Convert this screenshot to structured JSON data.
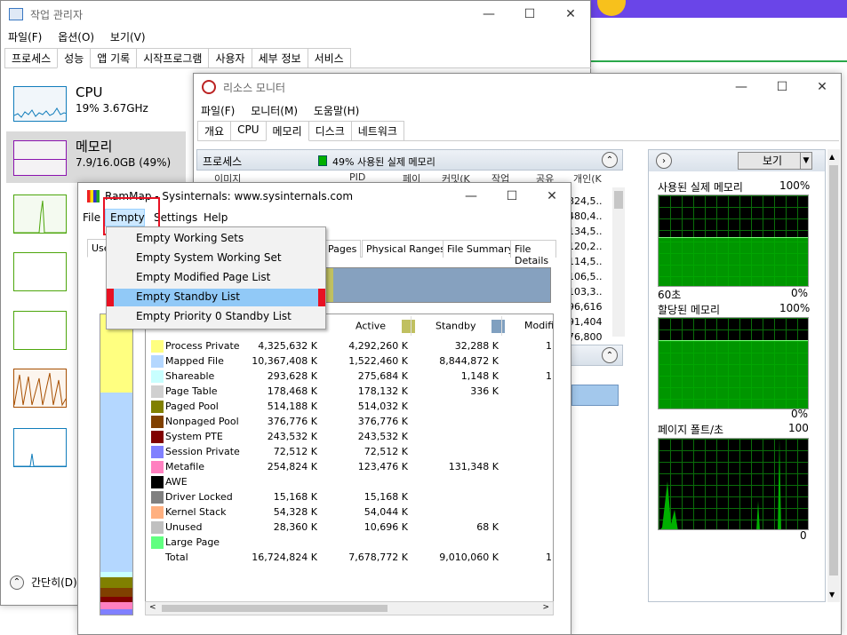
{
  "taskmgr": {
    "title": "작업 관리자",
    "menu": [
      "파일(F)",
      "옵션(O)",
      "보기(V)"
    ],
    "tabs": [
      "프로세스",
      "성능",
      "앱 기록",
      "시작프로그램",
      "사용자",
      "세부 정보",
      "서비스"
    ],
    "cpu": {
      "name": "CPU",
      "value": "19% 3.67GHz"
    },
    "memory": {
      "name": "메모리",
      "value": "7.9/16.0GB (49%)"
    },
    "fewer_details": "간단히(D)"
  },
  "resmon": {
    "title": "리소스 모니터",
    "menu": [
      "파일(F)",
      "모니터(M)",
      "도움말(H)"
    ],
    "tabs": [
      "개요",
      "CPU",
      "메모리",
      "디스크",
      "네트워크"
    ],
    "process_label": "프로세스",
    "usage_text": "49% 사용된 실제 메모리",
    "col_headers": [
      "이미지",
      "PID",
      "페이",
      "커밋(K",
      "작업",
      "공유",
      "개인(K"
    ],
    "col_values": [
      "824,5..",
      "480,4..",
      "134,5..",
      "120,2..",
      "114,5..",
      "106,5..",
      "103,3..",
      "96,616",
      "91,404",
      "76,800"
    ],
    "view_button": "보기",
    "graph1": {
      "title": "사용된 실제 메모리",
      "max": "100%",
      "time": "60초",
      "min": "0%"
    },
    "graph2": {
      "title": "할당된 메모리",
      "max": "100%",
      "min": "0%"
    },
    "graph3": {
      "title": "페이지 폴트/초",
      "max": "100",
      "min": "0"
    }
  },
  "rammap": {
    "title": "RamMap - Sysinternals: www.sysinternals.com",
    "menu": [
      "File",
      "Empty",
      "Settings",
      "Help"
    ],
    "tabs_visible": [
      "Use",
      "Pages",
      "Physical Ranges",
      "File Summary",
      "File Details"
    ],
    "dropdown": [
      "Empty Working Sets",
      "Empty System Working Set",
      "Empty Modified Page List",
      "Empty Standby List",
      "Empty Priority 0 Standby List"
    ],
    "headers": {
      "active": "Active",
      "standby": "Standby",
      "modified": "Modifie"
    },
    "rows": [
      {
        "name": "Process Private",
        "color": "#ffff80",
        "total": "4,325,632 K",
        "active": "4,292,260 K",
        "standby": "32,288 K",
        "modified": "1"
      },
      {
        "name": "Mapped File",
        "color": "#b4d7ff",
        "total": "10,367,408 K",
        "active": "1,522,460 K",
        "standby": "8,844,872 K",
        "modified": ""
      },
      {
        "name": "Shareable",
        "color": "#c8ffff",
        "total": "293,628 K",
        "active": "275,684 K",
        "standby": "1,148 K",
        "modified": "1"
      },
      {
        "name": "Page Table",
        "color": "#d0d0d0",
        "total": "178,468 K",
        "active": "178,132 K",
        "standby": "336 K",
        "modified": ""
      },
      {
        "name": "Paged Pool",
        "color": "#808000",
        "total": "514,188 K",
        "active": "514,032 K",
        "standby": "",
        "modified": ""
      },
      {
        "name": "Nonpaged Pool",
        "color": "#804000",
        "total": "376,776 K",
        "active": "376,776 K",
        "standby": "",
        "modified": ""
      },
      {
        "name": "System PTE",
        "color": "#800000",
        "total": "243,532 K",
        "active": "243,532 K",
        "standby": "",
        "modified": ""
      },
      {
        "name": "Session Private",
        "color": "#8080ff",
        "total": "72,512 K",
        "active": "72,512 K",
        "standby": "",
        "modified": ""
      },
      {
        "name": "Metafile",
        "color": "#ff80c0",
        "total": "254,824 K",
        "active": "123,476 K",
        "standby": "131,348 K",
        "modified": ""
      },
      {
        "name": "AWE",
        "color": "#000000",
        "total": "",
        "active": "",
        "standby": "",
        "modified": ""
      },
      {
        "name": "Driver Locked",
        "color": "#808080",
        "total": "15,168 K",
        "active": "15,168 K",
        "standby": "",
        "modified": ""
      },
      {
        "name": "Kernel Stack",
        "color": "#ffb080",
        "total": "54,328 K",
        "active": "54,044 K",
        "standby": "",
        "modified": ""
      },
      {
        "name": "Unused",
        "color": "#c0c0c0",
        "total": "28,360 K",
        "active": "10,696 K",
        "standby": "68 K",
        "modified": ""
      },
      {
        "name": "Large Page",
        "color": "#60ff80",
        "total": "",
        "active": "",
        "standby": "",
        "modified": ""
      },
      {
        "name": "Total",
        "color": "",
        "total": "16,724,824 K",
        "active": "7,678,772 K",
        "standby": "9,010,060 K",
        "modified": "1"
      }
    ]
  },
  "colors": {
    "accent": "#99c9ef",
    "highlight_red": "#e81123",
    "graph_green": "#00c800",
    "active_swatch": "#c0c060",
    "standby_swatch": "#80a0c0"
  }
}
